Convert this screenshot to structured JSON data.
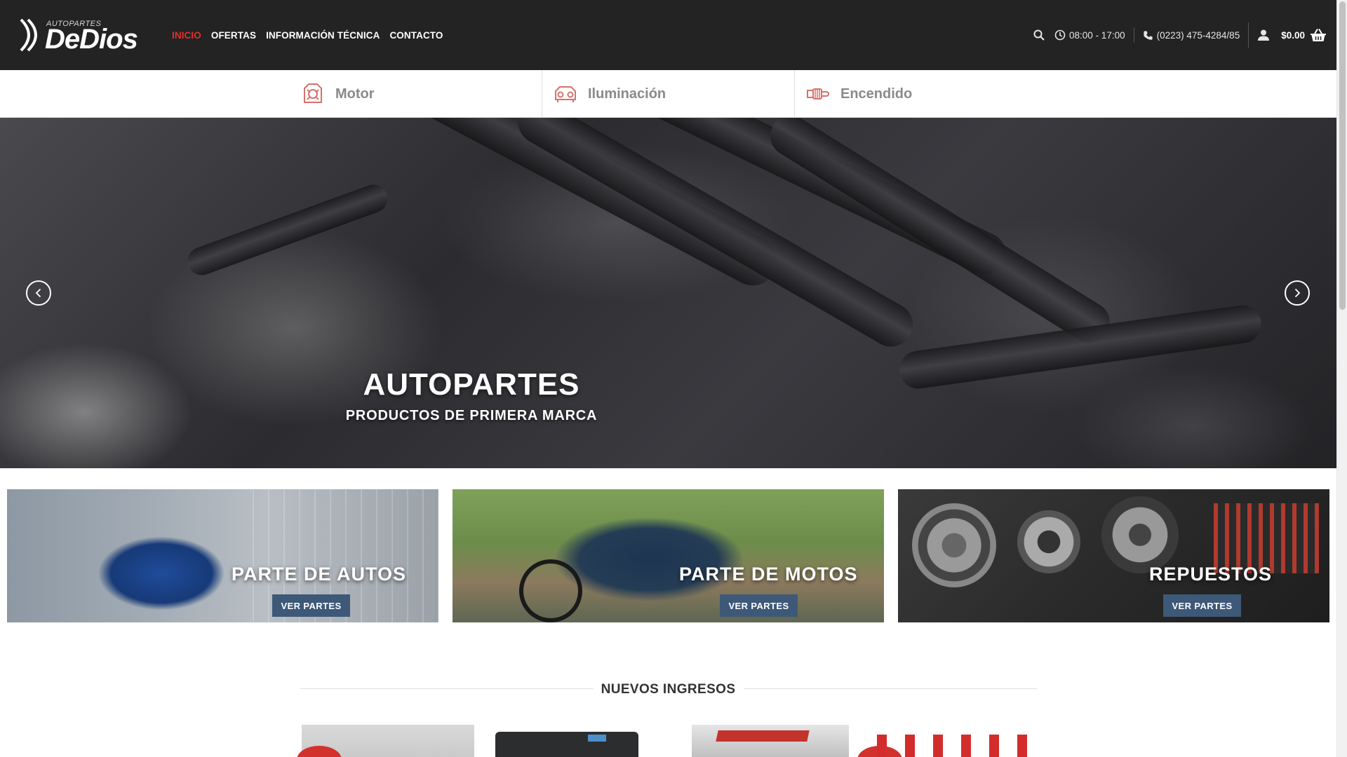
{
  "header": {
    "logo_small": "AUTOPARTES",
    "logo_big": "DeDios",
    "nav": [
      "INICIO",
      "OFERTAS",
      "INFORMACIÓN TÉCNICA",
      "CONTACTO"
    ],
    "active_nav": "INICIO",
    "hours": "08:00 - 17:00",
    "phone": "(0223) 475-4284/85",
    "cart_total": "$0.00",
    "icons": [
      "search-icon",
      "clock-icon",
      "phone-icon",
      "user-icon",
      "basket-icon"
    ]
  },
  "categories": [
    {
      "label": "Motor",
      "icon": "engine-icon"
    },
    {
      "label": "Iluminación",
      "icon": "headlight-icon"
    },
    {
      "label": "Encendido",
      "icon": "spark-plug-icon"
    }
  ],
  "hero": {
    "title": "AUTOPARTES",
    "subtitle": "PRODUCTOS DE PRIMERA MARCA"
  },
  "banners": [
    {
      "title": "PARTE DE AUTOS",
      "button": "VER PARTES"
    },
    {
      "title": "PARTE DE MOTOS",
      "button": "VER PARTES"
    },
    {
      "title": "REPUESTOS",
      "button": "VER PARTES"
    }
  ],
  "section": {
    "title": "NUEVOS INGRESOS"
  },
  "colors": {
    "header_bg": "#232323",
    "accent_red": "#e0302c",
    "button_blue": "#3e5878"
  }
}
